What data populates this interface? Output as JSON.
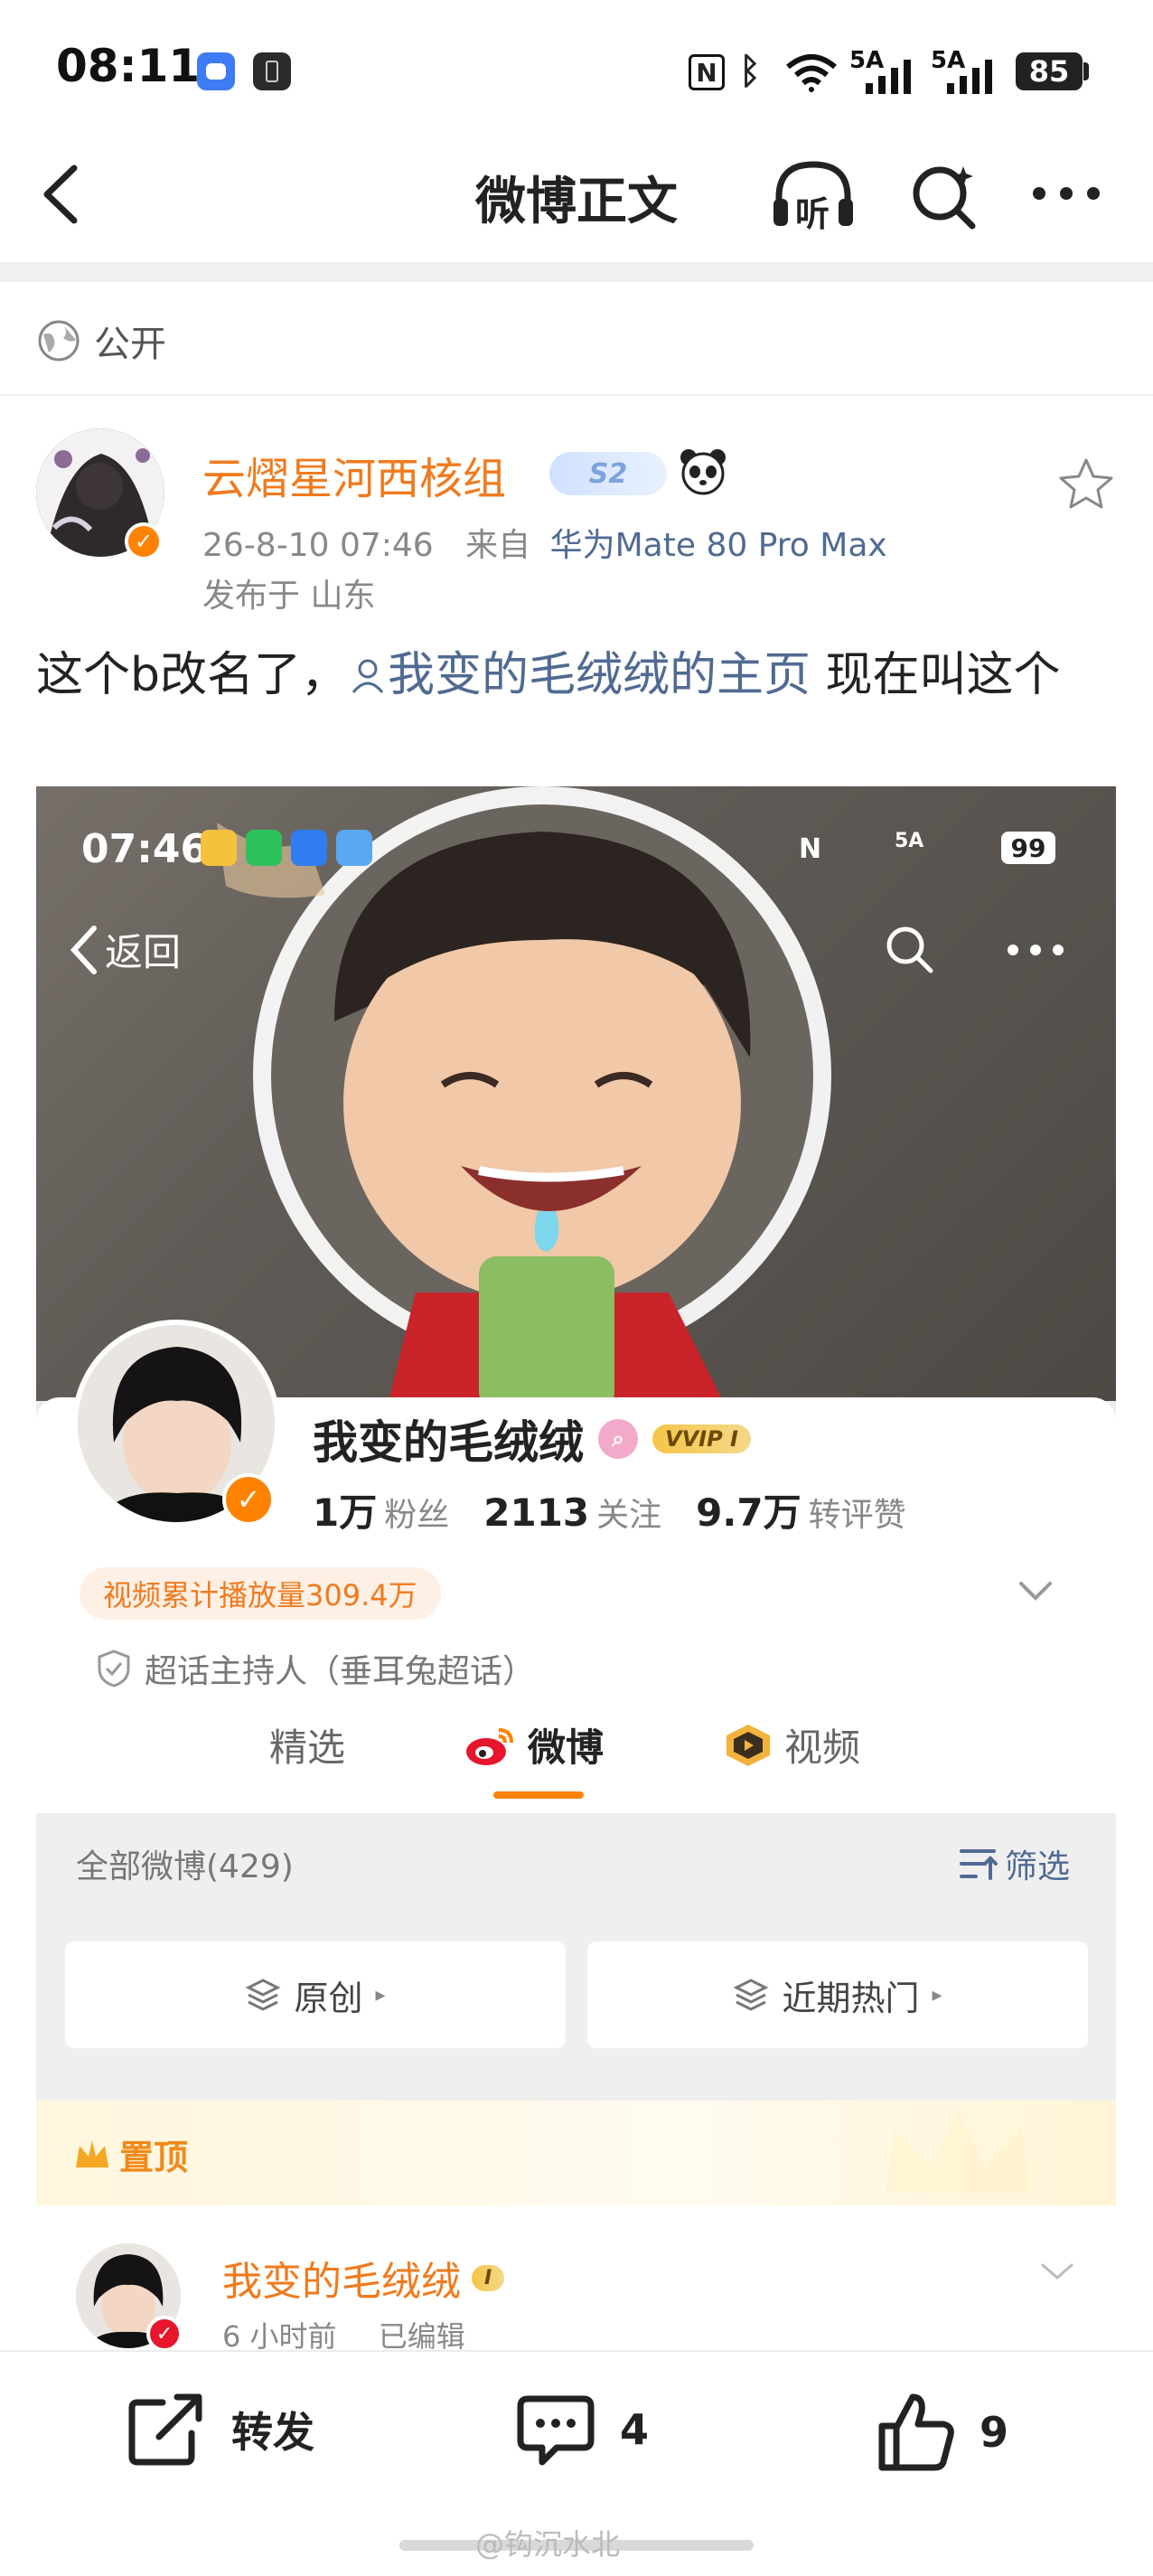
{
  "status_bar": {
    "time": "08:11",
    "net1": "5A",
    "net2": "5A",
    "battery": "85"
  },
  "nav": {
    "title": "微博正文",
    "listen_label": "听"
  },
  "visibility": {
    "label": "公开"
  },
  "post": {
    "author": "云熠星河西核组",
    "level_badge": "S2",
    "timestamp": "26-8-10 07:46",
    "source_prefix": "来自",
    "device": "华为Mate 80 Pro Max",
    "location": "发布于 山东",
    "text_before": "这个b改名了，",
    "mention": "我变的毛绒绒的主页",
    "text_after": " 现在叫这个"
  },
  "embedded": {
    "status_time": "07:46",
    "status_net": "5A",
    "status_battery": "99",
    "back_label": "返回",
    "profile_name": "我变的毛绒绒",
    "vvip": "VVIP I",
    "stats": [
      {
        "value": "1万",
        "label": "粉丝"
      },
      {
        "value": "2113",
        "label": "关注"
      },
      {
        "value": "9.7万",
        "label": "转评赞"
      }
    ],
    "play_count": "视频累计播放量309.4万",
    "host_line": "超话主持人（垂耳兔超话）",
    "tabs": [
      "精选",
      "微博",
      "视频"
    ],
    "all_weibo": "全部微博(429)",
    "filter": "筛选",
    "chips": [
      "原创",
      "近期热门"
    ],
    "pinned": "置顶",
    "post_author": "我变的毛绒绒",
    "post_vip": "I",
    "post_time": "6 小时前",
    "post_edited": "已编辑"
  },
  "actions": {
    "repost": "转发",
    "comments": "4",
    "likes": "9"
  },
  "watermark": "@钩沉水北",
  "colors": {
    "accent_orange": "#ff8200",
    "name_orange": "#f07a1d",
    "link_blue": "#506a92"
  }
}
